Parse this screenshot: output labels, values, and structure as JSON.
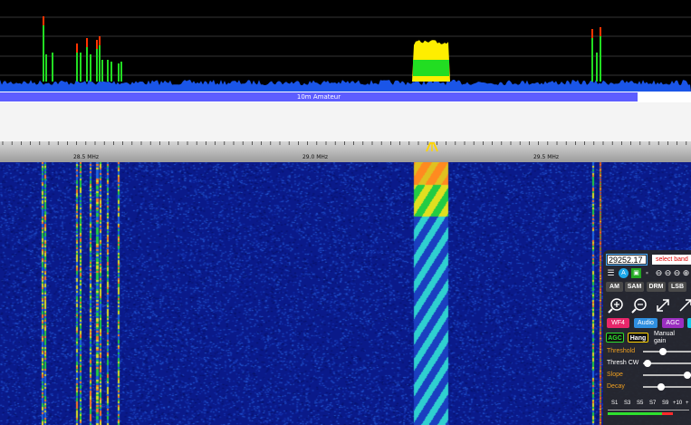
{
  "spectrum": {
    "band_label": "10m Amateur"
  },
  "scale": {
    "ticks": [
      {
        "label": "28.5 MHz"
      },
      {
        "label": "29.0 MHz"
      },
      {
        "label": "29.5 MHz"
      }
    ]
  },
  "control_panel": {
    "frequency_value": "29252.17",
    "select_band_label": "select band",
    "modes": [
      "AM",
      "SAM",
      "DRM",
      "LSB"
    ],
    "tabs": [
      "WF4",
      "Audio",
      "AGC"
    ],
    "agc_label": "AGC",
    "hang_label": "Hang",
    "manual_gain_label": "Manual gain",
    "sliders": [
      "Threshold",
      "Thresh CW",
      "Slope",
      "Decay"
    ],
    "smeter_labels": [
      "S1",
      "S3",
      "S5",
      "S7",
      "S9",
      "+10",
      "+"
    ]
  },
  "colors": {
    "spectrum_base": "#1a55e8",
    "spectrum_mid": "#22dd22",
    "spectrum_high": "#ffee00",
    "spectrum_peak": "#ff3300",
    "waterfall_bg": "#0a1a8a",
    "band_bar": "#5d5dff",
    "tab_wf": "#e8266a",
    "tab_audio": "#2f8fe0",
    "tab_agc": "#9b2fc0"
  }
}
